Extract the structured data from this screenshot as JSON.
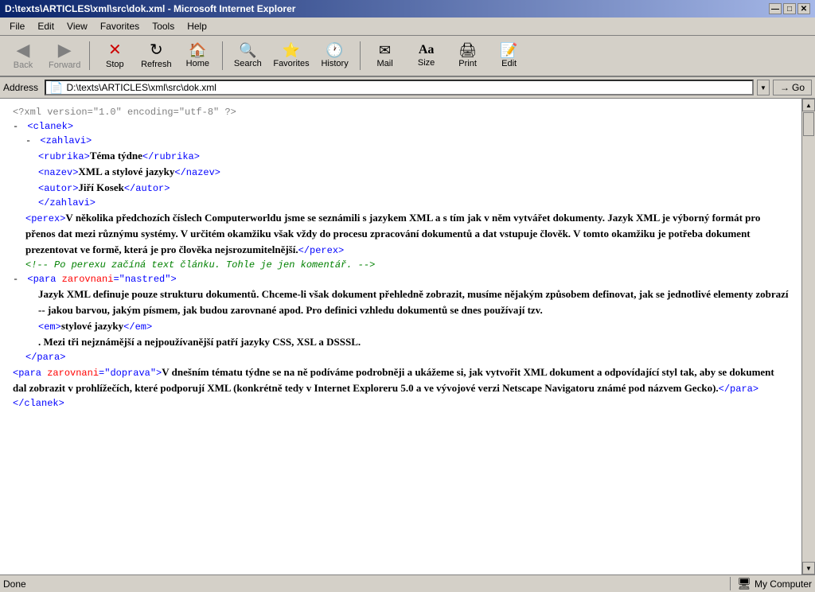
{
  "window": {
    "title": "D:\\texts\\ARTICLES\\xml\\src\\dok.xml - Microsoft Internet Explorer",
    "title_icon": "🌐"
  },
  "title_buttons": {
    "minimize": "—",
    "maximize": "□",
    "close": "✕"
  },
  "menu": {
    "items": [
      "File",
      "Edit",
      "View",
      "Favorites",
      "Tools",
      "Help"
    ]
  },
  "toolbar": {
    "buttons": [
      {
        "id": "back",
        "label": "Back",
        "icon": "◀",
        "disabled": true
      },
      {
        "id": "forward",
        "label": "Forward",
        "icon": "▶",
        "disabled": true
      },
      {
        "id": "stop",
        "label": "Stop",
        "icon": "✕",
        "disabled": false
      },
      {
        "id": "refresh",
        "label": "Refresh",
        "icon": "↻",
        "disabled": false
      },
      {
        "id": "home",
        "label": "Home",
        "icon": "🏠",
        "disabled": false
      },
      {
        "id": "search",
        "label": "Search",
        "icon": "🔍",
        "disabled": false
      },
      {
        "id": "favorites",
        "label": "Favorites",
        "icon": "⭐",
        "disabled": false
      },
      {
        "id": "history",
        "label": "History",
        "icon": "📋",
        "disabled": false
      },
      {
        "id": "mail",
        "label": "Mail",
        "icon": "✉",
        "disabled": false
      },
      {
        "id": "size",
        "label": "Size",
        "icon": "Aa",
        "disabled": false
      },
      {
        "id": "print",
        "label": "Print",
        "icon": "🖨",
        "disabled": false
      },
      {
        "id": "edit",
        "label": "Edit",
        "icon": "📝",
        "disabled": false
      }
    ]
  },
  "address": {
    "label": "Address",
    "value": "D:\\texts\\ARTICLES\\xml\\src\\dok.xml",
    "go_label": "Go",
    "go_arrow": "→"
  },
  "content": {
    "xml_declaration": "<?xml version=\"1.0\" encoding=\"utf-8\" ?>",
    "lines": []
  },
  "status": {
    "text": "Done",
    "zone_icon": "🖥",
    "zone_label": "My Computer"
  }
}
